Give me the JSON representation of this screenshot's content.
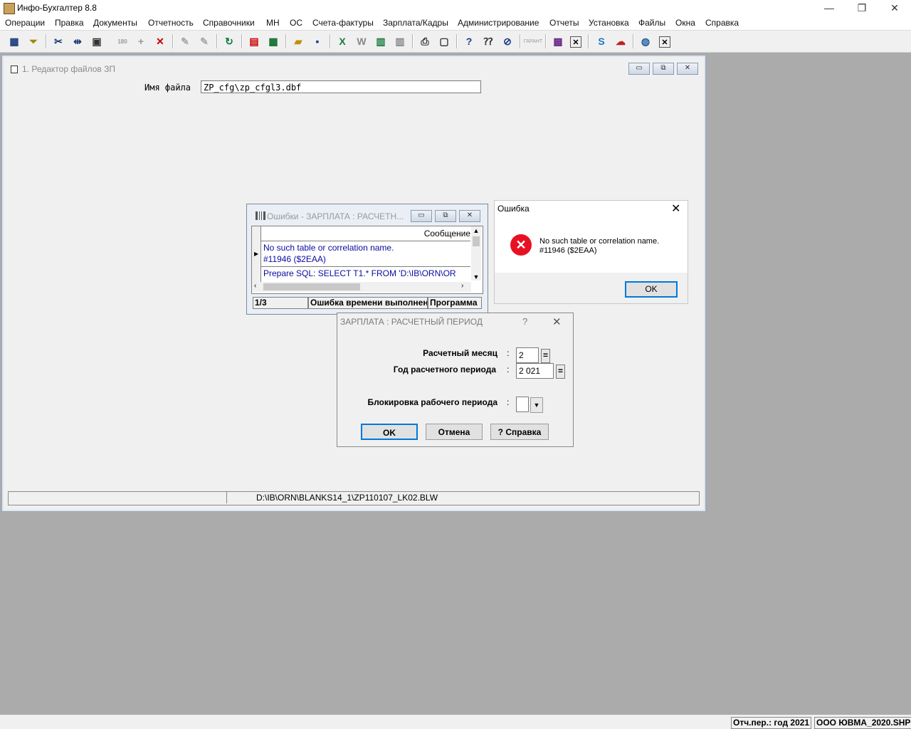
{
  "app": {
    "title": "Инфо-Бухгалтер 8.8",
    "caption_buttons": {
      "minimize": "—",
      "restore": "❐",
      "close": "✕"
    }
  },
  "menu": [
    "Операции",
    "Правка",
    "Документы",
    "Отчетность",
    "Справочники",
    "МН",
    "ОС",
    "Счета-фактуры",
    "Зарплата/Кадры",
    "Администрирование",
    "Отчеты",
    "Установка",
    "Файлы",
    "Окна",
    "Справка"
  ],
  "toolbar": {
    "icons": [
      "grid-icon",
      "filter-icon",
      "cut-icon",
      "split-icon",
      "paste-icon",
      "rotate-icon",
      "plus-icon",
      "delete-icon",
      "pen-icon",
      "pen-sheet-icon",
      "refresh-icon",
      "report-icon",
      "calculator-icon",
      "open-folder-icon",
      "save-icon",
      "excel-icon",
      "word-icon",
      "export-icon",
      "import-icon",
      "print-icon",
      "preview-icon",
      "help-icon",
      "context-help-icon",
      "compass-icon",
      "garant-icon",
      "film-icon",
      "close-icon",
      "skype-icon",
      "chat-icon",
      "globe-icon",
      "close-icon-2"
    ],
    "garant_label": "ГАРАНТ"
  },
  "editor": {
    "title": "1. Редактор файлов ЗП",
    "filename_label": "Имя файла",
    "filename_value": "ZP_cfg\\zp_cfgl3.dbf",
    "status_path": "D:\\IB\\ORN\\BLANKS14_1\\ZP110107_LK02.BLW"
  },
  "errors_window": {
    "title": "Ошибки - ЗАРПЛАТА : РАСЧЕТН...",
    "column_header": "Сообщение",
    "rows": [
      {
        "line1": "No such table or correlation name.",
        "line2": "#11946 ($2EAA)"
      },
      {
        "line1": "Prepare SQL: SELECT T1.* FROM 'D:\\IB\\ORN\\OR",
        "line2": ""
      }
    ],
    "footer": {
      "position": "1/3",
      "type": "Ошибка времени выполнен",
      "source": "Программа"
    }
  },
  "error_box": {
    "title": "Ошибка",
    "message_line1": "No such table or correlation name.",
    "message_line2": "#11946 ($2EAA)",
    "ok_label": "OK"
  },
  "period_dialog": {
    "title": "ЗАРПЛАТА : РАСЧЕТНЫЙ ПЕРИОД",
    "help_mark": "?",
    "month_label": "Расчетный месяц",
    "month_value": "2",
    "year_label": "Год расчетного периода",
    "year_value": "2 021",
    "lock_label": "Блокировка рабочего периода",
    "colon": ":",
    "eq": "=",
    "ok_label": "OK",
    "cancel_label": "Отмена",
    "help_label": "? Справка"
  },
  "statusbar": {
    "period": "Отч.пер.: год 2021",
    "org": "ООО ЮВМА_2020.SHP"
  }
}
